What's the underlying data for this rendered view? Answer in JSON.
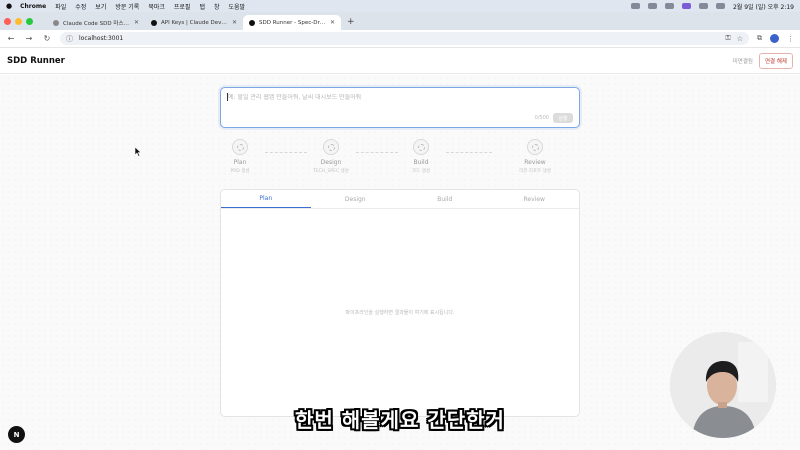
{
  "menubar": {
    "app": "Chrome",
    "items": [
      "파일",
      "수정",
      "보기",
      "방문 기록",
      "북마크",
      "프로필",
      "탭",
      "창",
      "도움말"
    ],
    "datetime": "2월 9일 (일) 오후 2:19"
  },
  "tabs": [
    {
      "title": "Claude Code SDD 마스터 클래스"
    },
    {
      "title": "API Keys | Claude Developer"
    },
    {
      "title": "SDD Runner - Spec-Driven De..."
    }
  ],
  "address": {
    "url": "localhost:3001"
  },
  "app": {
    "brand": "SDD Runner",
    "connection_status": "미연결됨",
    "disconnect_label": "연결 해제"
  },
  "prompt": {
    "placeholder": "예: 할일 관리 웹앱 만들어줘, 날씨 대시보드 만들어줘",
    "char_count": "0/500",
    "run_label": "실행"
  },
  "steps": [
    {
      "name": "Plan",
      "sub": "PRD 생성"
    },
    {
      "name": "Design",
      "sub": "TECH_SPEC 생성"
    },
    {
      "name": "Build",
      "sub": "코드 생성"
    },
    {
      "name": "Review",
      "sub": "리뷰 리포트 생성"
    }
  ],
  "panel_tabs": [
    "Plan",
    "Design",
    "Build",
    "Review"
  ],
  "active_panel_tab": "Plan",
  "empty_message": "파이프라인을 실행하면 결과물이 여기에 표시됩니다.",
  "badge": "N",
  "caption": "한번 해볼게요 간단한거",
  "colors": {
    "accent": "#3a6fd0",
    "disconnect": "#c0392b"
  }
}
